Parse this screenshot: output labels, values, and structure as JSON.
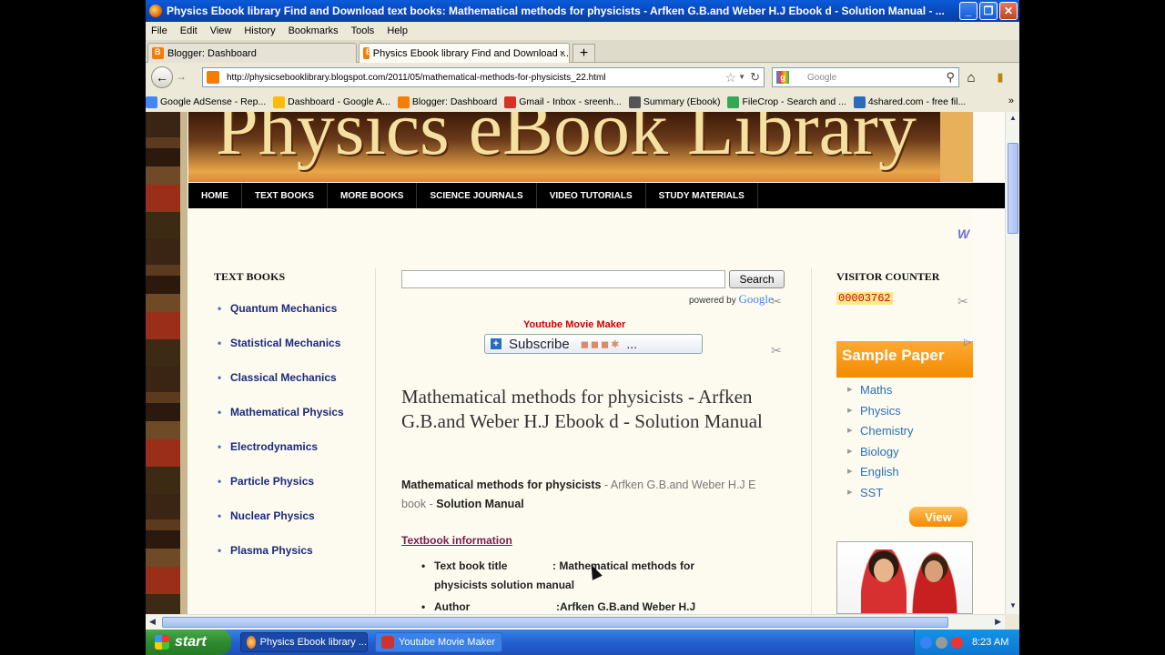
{
  "window": {
    "title": "Physics Ebook library Find and Download text books: Mathematical methods for physicists - Arfken G.B.and Weber H.J Ebook d - Solution Manual - ..."
  },
  "menu": [
    "File",
    "Edit",
    "View",
    "History",
    "Bookmarks",
    "Tools",
    "Help"
  ],
  "tabs": [
    {
      "label": "Blogger: Dashboard"
    },
    {
      "label": "Physics Ebook library Find and Download ...",
      "close": "×"
    }
  ],
  "newtab": "+",
  "nav": {
    "url": "http://physicsebooklibrary.blogspot.com/2011/05/mathematical-methods-for-physicists_22.html",
    "search_placeholder": "Google"
  },
  "bookmarks": [
    {
      "label": "Google AdSense - Rep...",
      "color": "#4285f4"
    },
    {
      "label": "Dashboard - Google A...",
      "color": "#fbbc05"
    },
    {
      "label": "Blogger: Dashboard",
      "color": "#f57d00"
    },
    {
      "label": "Gmail - Inbox - sreenh...",
      "color": "#d93025"
    },
    {
      "label": "Summary (Ebook)",
      "color": "#555555"
    },
    {
      "label": "FileCrop - Search and ...",
      "color": "#34a853"
    },
    {
      "label": "4shared.com - free fil...",
      "color": "#2b6cb8"
    }
  ],
  "site": {
    "banner": "Physics eBook Library",
    "menu": [
      "HOME",
      "TEXT BOOKS",
      "MORE BOOKS",
      "SCIENCE JOURNALS",
      "VIDEO TUTORIALS",
      "STUDY MATERIALS"
    ],
    "left_heading": "TEXT BOOKS",
    "left_items": [
      "Quantum Mechanics",
      "Statistical Mechanics",
      "Classical Mechanics",
      "Mathematical Physics",
      "Electrodynamics",
      "Particle Physics",
      "Nuclear Physics",
      "Plasma Physics"
    ],
    "search_button": "Search",
    "powered_by": "powered by",
    "powered_brand": "Google",
    "youtube_label": "Youtube Movie Maker",
    "subscribe_label": "Subscribe",
    "subscribe_more": "...",
    "post_title": "Mathematical methods for physicists - Arfken G.B.and Weber H.J Ebook d - Solution Manual",
    "intro_bold1": "Mathematical methods for physicists",
    "intro_mid": " - Arfken G.B.and Weber H.J E book - ",
    "intro_bold2": "Solution Manual",
    "textbook_info": "Textbook information",
    "specs": [
      {
        "label": "Text book title",
        "value": ": Mathematical methods for physicists solution manual"
      },
      {
        "label": "Author",
        "value": ":Arfken G.B.and Weber H.J"
      }
    ],
    "right_heading": "VISITOR COUNTER",
    "counter": "00003762",
    "ad_title": "Sample Paper",
    "ad_items": [
      "Maths",
      "Physics",
      "Chemistry",
      "Biology",
      "English",
      "SST"
    ],
    "ad_button": "View"
  },
  "taskbar": {
    "start": "start",
    "tasks": [
      "Physics Ebook library ...",
      "Youtube Movie Maker"
    ],
    "clock": "8:23 AM"
  }
}
